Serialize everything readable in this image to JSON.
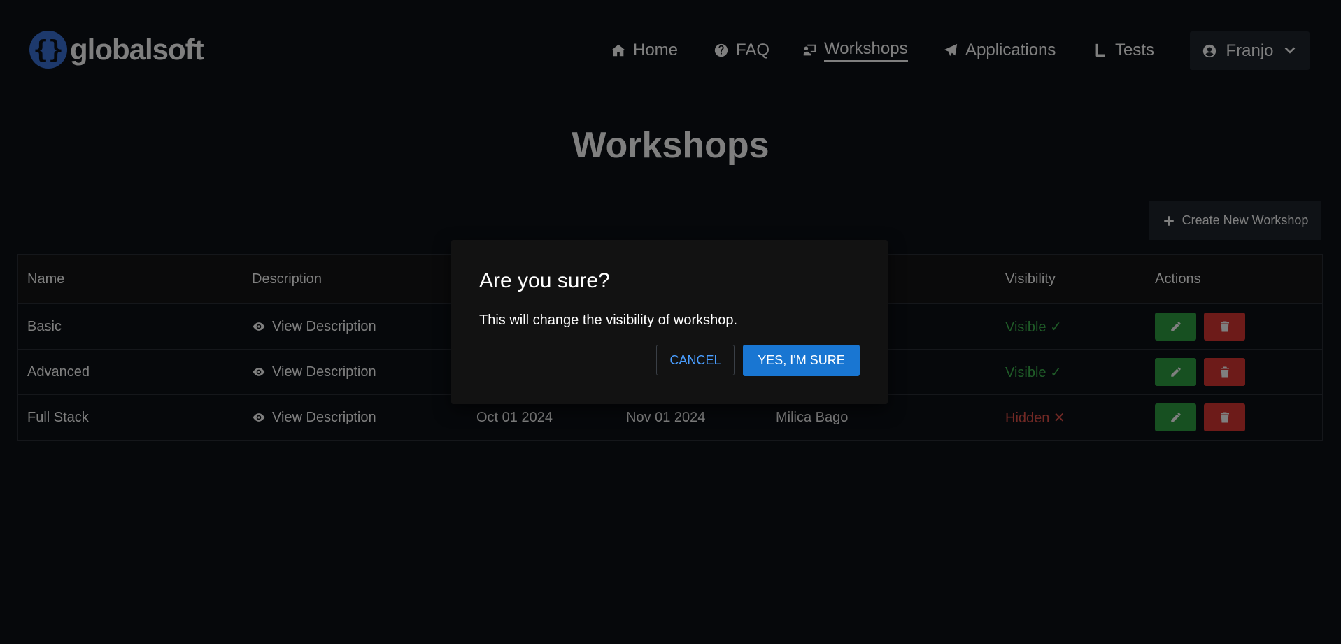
{
  "brand": {
    "logo_mark": "{}",
    "name": "globalsoft"
  },
  "nav": [
    {
      "label": "Home",
      "icon": "home-icon"
    },
    {
      "label": "FAQ",
      "icon": "question-circle-icon"
    },
    {
      "label": "Workshops",
      "icon": "chalkboard-teacher-icon",
      "active": true
    },
    {
      "label": "Applications",
      "icon": "paper-plane-icon"
    },
    {
      "label": "Tests",
      "icon": "book-icon"
    }
  ],
  "user": {
    "name": "Franjo",
    "icon": "user-circle-icon"
  },
  "page": {
    "title": "Workshops",
    "create_label": "Create New Workshop"
  },
  "table": {
    "headers": [
      "Name",
      "Description",
      "",
      "",
      "",
      "Visibility",
      "Actions"
    ],
    "rows": [
      {
        "name": "Basic",
        "description": "View Description",
        "start": "",
        "end": "",
        "lecturer": "",
        "visibility": "Visible ✓"
      },
      {
        "name": "Advanced",
        "description": "View Description",
        "start": "",
        "end": "",
        "lecturer": "",
        "visibility": "Visible ✓"
      },
      {
        "name": "Full Stack",
        "description": "View Description",
        "start": "Oct 01 2024",
        "end": "Nov 01 2024",
        "lecturer": "Milica Bago",
        "visibility": "Hidden ✕"
      }
    ]
  },
  "dialog": {
    "title": "Are you sure?",
    "message": "This will change the visibility of workshop.",
    "cancel_label": "CANCEL",
    "confirm_label": "YES, I'M SURE"
  },
  "colors": {
    "background": "#0d1117",
    "visible": "#3fb950",
    "hidden": "#e5534b",
    "edit": "#2ea043",
    "delete": "#da3633",
    "primary": "#1976d2"
  }
}
